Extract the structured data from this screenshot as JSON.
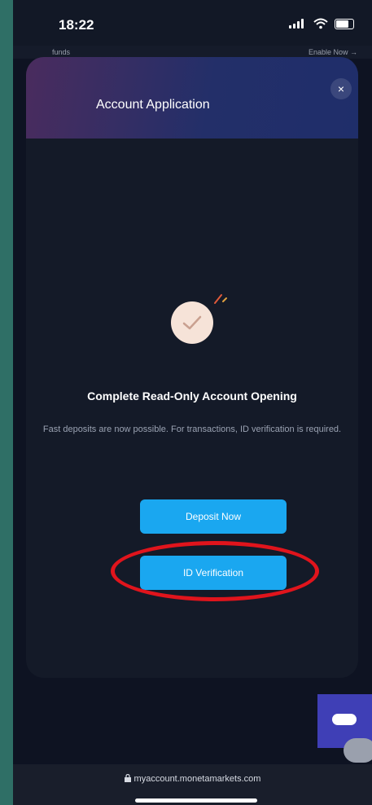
{
  "status_bar": {
    "time": "18:22"
  },
  "background_strip": {
    "left_text": "funds",
    "right_text": "Enable Now →"
  },
  "modal": {
    "title": "Account Application",
    "close_label": "×",
    "success_title": "Complete Read-Only Account Opening",
    "success_desc": "Fast deposits are now possible. For transactions, ID verification is required.",
    "primary_button": "Deposit Now",
    "secondary_button": "ID Verification"
  },
  "browser": {
    "url": "myaccount.monetamarkets.com"
  },
  "colors": {
    "accent": "#1aa7f0",
    "highlight": "#e0141c",
    "modal_bg": "#141a28"
  }
}
